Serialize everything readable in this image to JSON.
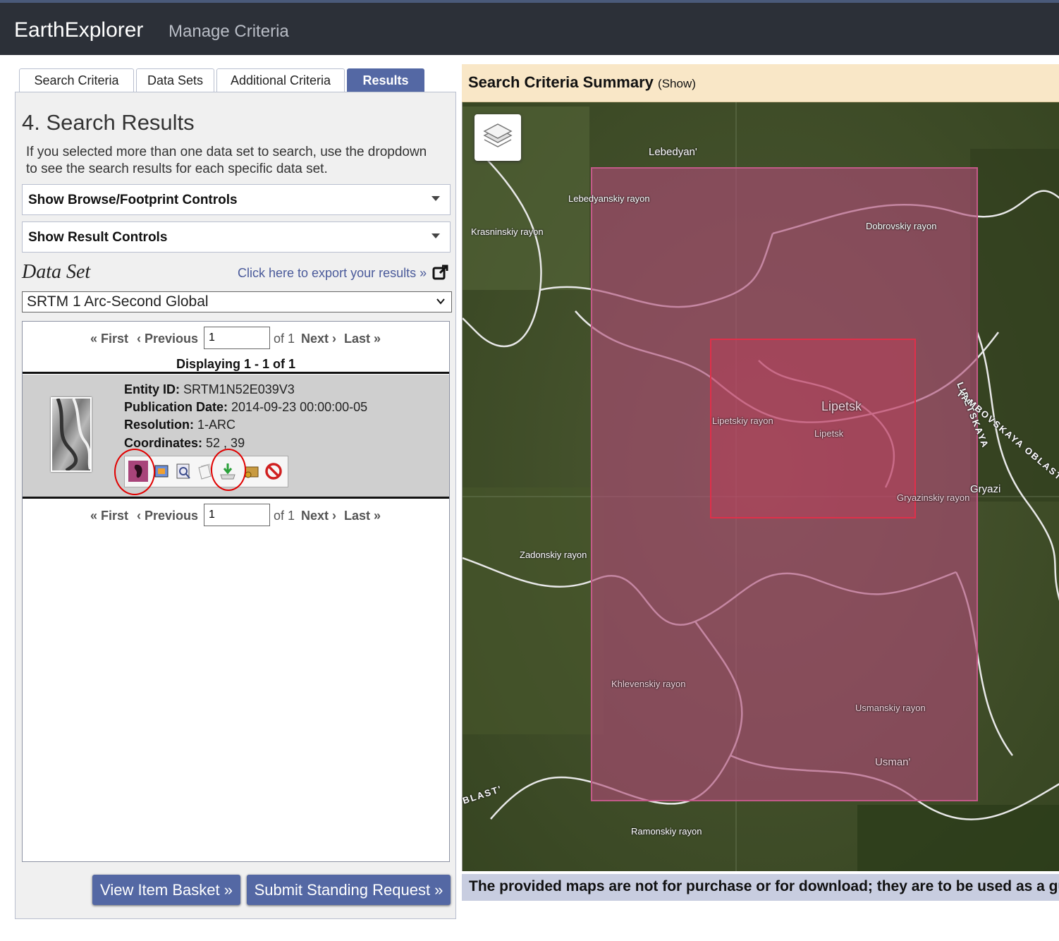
{
  "header": {
    "brand": "EarthExplorer",
    "manage": "Manage Criteria"
  },
  "tabs": [
    {
      "label": "Search Criteria",
      "active": false
    },
    {
      "label": "Data Sets",
      "active": false
    },
    {
      "label": "Additional Criteria",
      "active": false
    },
    {
      "label": "Results",
      "active": true
    }
  ],
  "results_panel": {
    "heading": "4. Search Results",
    "intro": "If you selected more than one data set to search, use the dropdown to see the search results for each specific data set.",
    "browse_controls": "Show Browse/Footprint Controls",
    "result_controls": "Show Result Controls",
    "dataset_label": "Data Set",
    "export_link": "Click here to export your results »",
    "dataset_selected": "SRTM 1 Arc-Second Global",
    "pager": {
      "first": "« First",
      "previous": "‹ Previous",
      "page_value": "1",
      "of": "of 1",
      "next": "Next ›",
      "last": "Last »"
    },
    "displaying": "Displaying 1 - 1 of 1",
    "result": {
      "entity_label": "Entity ID:",
      "entity_value": "SRTM1N52E039V3",
      "pubdate_label": "Publication Date:",
      "pubdate_value": "2014-09-23 00:00:00-05",
      "resolution_label": "Resolution:",
      "resolution_value": "1-ARC",
      "coords_label": "Coordinates:",
      "coords_value": "52 , 39",
      "tool_icons": [
        "footprint-icon",
        "browse-overlay-icon",
        "metadata-icon",
        "compare-icon",
        "download-icon",
        "add-to-basket-icon",
        "exclude-icon"
      ]
    },
    "buttons": {
      "basket": "View Item Basket »",
      "standing": "Submit Standing Request »"
    }
  },
  "map": {
    "summary_title": "Search Criteria Summary",
    "summary_show": "(Show)",
    "labels": [
      "Lebedyan'",
      "Lebedyanskiy rayon",
      "Krasninskiy rayon",
      "Dobrovskiy rayon",
      "Lipetsk",
      "Lipetskiy rayon",
      "Lipetsk",
      "LIPETSKAYA",
      "TAMBOVSKAYA OBLAST'",
      "Gryazi",
      "Gryazinskiy rayon",
      "Zadonskiy rayon",
      "Khlevenskiy rayon",
      "Usmanskiy rayon",
      "Usman'",
      "Ramonskiy rayon",
      "BLAST'"
    ],
    "disclaimer": "The provided maps are not for purchase or for download; they are to be used as a guide for reference and search purposes only.",
    "colors": {
      "footprint_fill": "#b04a78",
      "selected_outline": "#e0304a",
      "topbar": "#2c3038",
      "accent": "#5468a4"
    }
  }
}
